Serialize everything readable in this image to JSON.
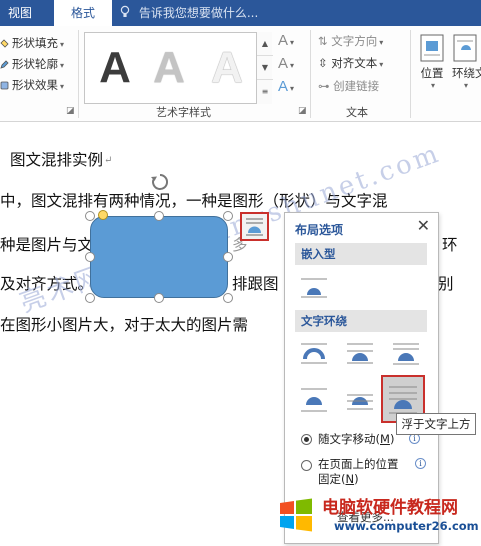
{
  "tabs": [
    {
      "label": "视图",
      "active": false
    },
    {
      "label": "格式",
      "active": true
    }
  ],
  "tell_me": {
    "placeholder": "告诉我您想要做什么..."
  },
  "ribbon": {
    "shape_styles": {
      "items": [
        {
          "label": "形状填充",
          "icon": "paint-bucket-icon"
        },
        {
          "label": "形状轮廓",
          "icon": "pen-outline-icon"
        },
        {
          "label": "形状效果",
          "icon": "shape-effect-icon"
        }
      ]
    },
    "wordart": {
      "label": "艺术字样式",
      "samples": [
        {
          "letter": "A",
          "fill": "#3c3c3c"
        },
        {
          "letter": "A",
          "fill": "#bfbfbf"
        },
        {
          "letter": "A",
          "fill": "#f2f2f2"
        }
      ],
      "small_buttons": [
        "A",
        "A",
        "A"
      ]
    },
    "text": {
      "label": "文本",
      "items": [
        {
          "label": "文字方向",
          "enabled": false
        },
        {
          "label": "对齐文本",
          "enabled": true
        },
        {
          "label": "创建链接",
          "enabled": false
        }
      ]
    },
    "arrange": {
      "position_label": "位置",
      "wrap_label": "环绕文"
    }
  },
  "document": {
    "lines": [
      "图文混排实例",
      "中，图文混排有两种情况，一种是图形（形状）与文字混",
      "种是图片与文",
      "及对齐方式。",
      "在图形小图片大，对于太大的图片需"
    ],
    "fragments": {
      "line3_right": "多",
      "line3_far": "环",
      "line4_right": "排跟图",
      "line4_far": "别"
    },
    "watermark": "亮术网 www.liangshunet.com"
  },
  "layout_panel": {
    "title": "布局选项",
    "close_symbol": "✕",
    "inline_section": "嵌入型",
    "wrap_section": "文字环绕",
    "wrap_options": [
      {
        "name": "square",
        "selected": false
      },
      {
        "name": "tight",
        "selected": false
      },
      {
        "name": "through",
        "selected": false
      },
      {
        "name": "top-and-bottom",
        "selected": false
      },
      {
        "name": "behind-text",
        "selected": false
      },
      {
        "name": "in-front-of-text",
        "selected": true
      }
    ],
    "tooltip": "浮于文字上方",
    "radio_options": [
      {
        "label": "随文字移动(M)",
        "checked": true
      },
      {
        "label": "在页面上的位置固定(N)",
        "checked": false
      }
    ],
    "radio_line1": "随文字移动(",
    "radio_key1": "M",
    "radio_line2a": "在页面上的位置",
    "radio_line2b": "固定(",
    "radio_key2": "N",
    "see_more": "查看更多..."
  },
  "site_logo": {
    "name": "电脑软硬件教程网",
    "url": "www.computer26.com"
  },
  "colors": {
    "ribbon_blue": "#2b579a",
    "shape_fill": "#5b9bd5",
    "highlight_red": "#c9302c",
    "logo_red": "#c8281e",
    "logo_blue": "#1a4f96"
  }
}
